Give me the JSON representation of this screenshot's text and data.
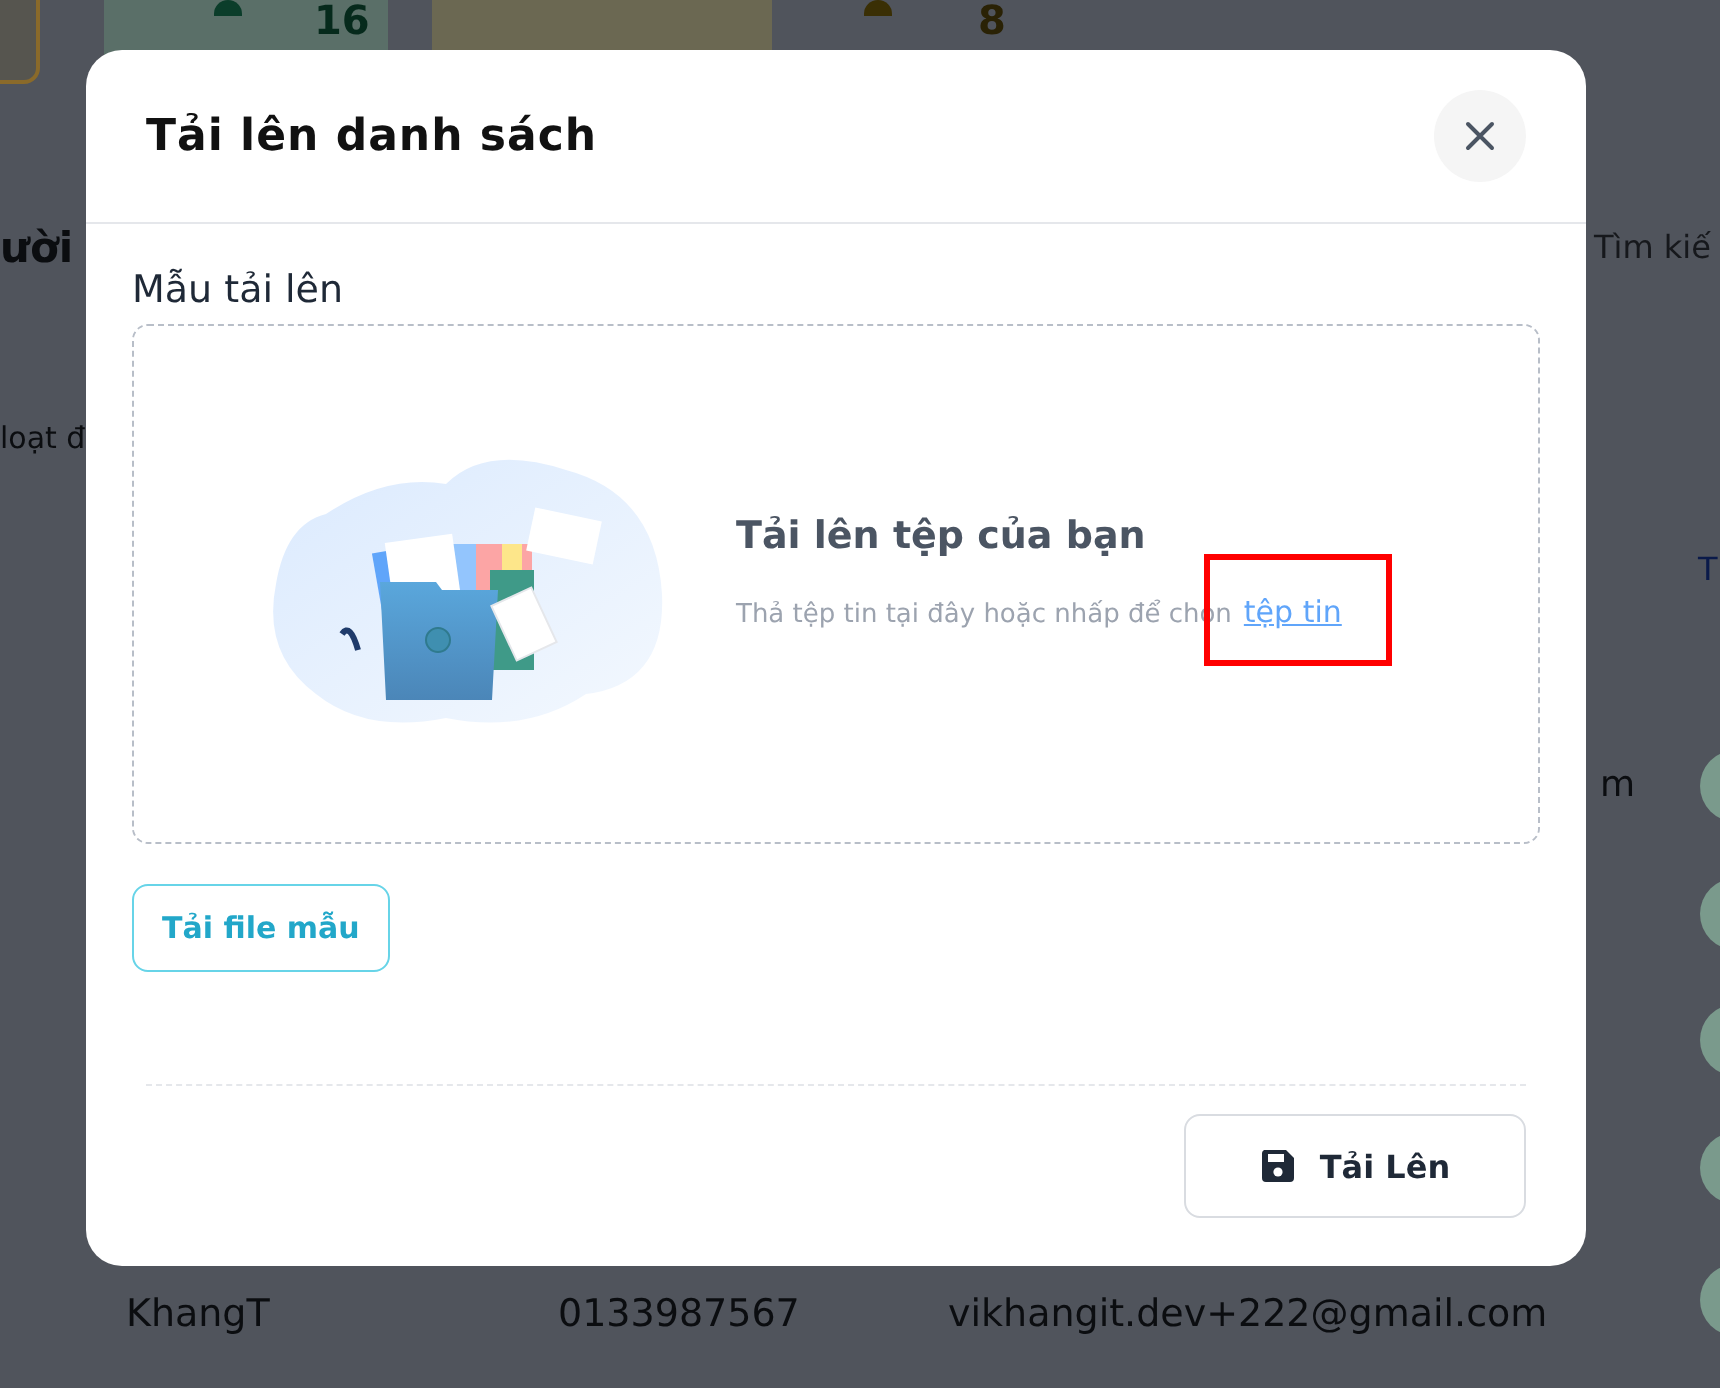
{
  "background": {
    "stats": [
      {
        "value": "16",
        "kind": "green"
      },
      {
        "value": "8",
        "kind": "yellow"
      }
    ],
    "section_title": "ười",
    "search_placeholder": "Tìm kiế",
    "filter_label": "loạt đ",
    "column_fragment": "T",
    "cell_fragment": "m",
    "row": {
      "name": "KhangT",
      "phone": "0133987567",
      "email": "vikhangit.dev+222@gmail.com"
    }
  },
  "dialog": {
    "title": "Tải lên danh sách",
    "field_label": "Mẫu tải lên",
    "dropzone": {
      "heading": "Tải lên tệp của bạn",
      "hint": "Thả tệp tin tại đây hoặc nhấp để chọn",
      "link": "tệp tin",
      "link_highlighted": true
    },
    "template_button": "Tải file mẫu",
    "submit_button": "Tải Lên"
  }
}
